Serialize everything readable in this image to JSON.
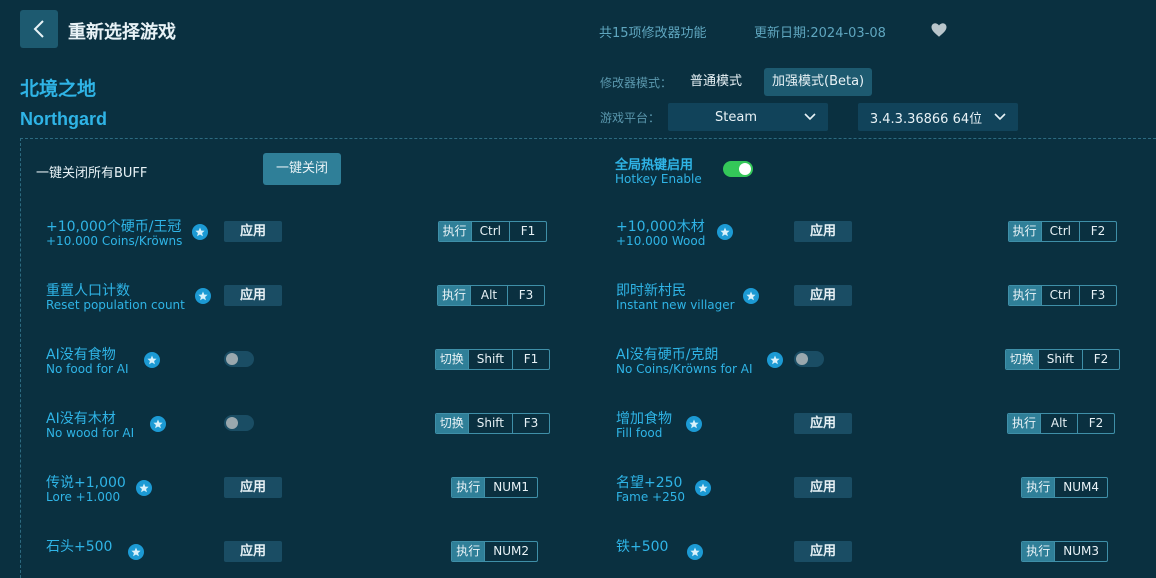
{
  "header": {
    "title": "重新选择游戏",
    "feature_count": "共15项修改器功能",
    "update_date": "更新日期:2024-03-08"
  },
  "game": {
    "name_cn": "北境之地",
    "name_en": "Northgard"
  },
  "mode": {
    "label": "修改器模式：",
    "normal": "普通模式",
    "beta": "加强模式(Beta)"
  },
  "platform": {
    "label": "游戏平台：",
    "selected": "Steam",
    "version": "3.4.3.36866 64位"
  },
  "buff": {
    "label": "一键关闭所有BUFF",
    "button": "一键关闭"
  },
  "hotkey": {
    "cn": "全局热键启用",
    "en": "Hotkey Enable",
    "enabled": true
  },
  "features": [
    {
      "cn": "+10,000个硬币/王冠",
      "en": "+10.000 Coins/Kröwns",
      "control": "apply",
      "control_label": "应用",
      "action": "执行",
      "keys": [
        "Ctrl",
        "F1"
      ]
    },
    {
      "cn": "+10,000木材",
      "en": "+10.000 Wood",
      "control": "apply",
      "control_label": "应用",
      "action": "执行",
      "keys": [
        "Ctrl",
        "F2"
      ]
    },
    {
      "cn": "重置人口计数",
      "en": "Reset population count",
      "control": "apply",
      "control_label": "应用",
      "action": "执行",
      "keys": [
        "Alt",
        "F3"
      ]
    },
    {
      "cn": "即时新村民",
      "en": "Instant new villager",
      "control": "apply",
      "control_label": "应用",
      "action": "执行",
      "keys": [
        "Ctrl",
        "F3"
      ]
    },
    {
      "cn": "AI没有食物",
      "en": "No food for AI",
      "control": "toggle",
      "action": "切换",
      "keys": [
        "Shift",
        "F1"
      ]
    },
    {
      "cn": "AI没有硬币/克朗",
      "en": "No Coins/Kröwns for AI",
      "control": "toggle",
      "action": "切换",
      "keys": [
        "Shift",
        "F2"
      ]
    },
    {
      "cn": "AI没有木材",
      "en": "No wood for AI",
      "control": "toggle",
      "action": "切换",
      "keys": [
        "Shift",
        "F3"
      ]
    },
    {
      "cn": "增加食物",
      "en": "Fill food",
      "control": "apply",
      "control_label": "应用",
      "action": "执行",
      "keys": [
        "Alt",
        "F2"
      ]
    },
    {
      "cn": "传说+1,000",
      "en": "Lore +1.000",
      "control": "apply",
      "control_label": "应用",
      "action": "执行",
      "keys": [
        "NUM1"
      ]
    },
    {
      "cn": "名望+250",
      "en": "Fame +250",
      "control": "apply",
      "control_label": "应用",
      "action": "执行",
      "keys": [
        "NUM4"
      ]
    },
    {
      "cn": "石头+500",
      "en": "",
      "control": "apply",
      "control_label": "应用",
      "action": "执行",
      "keys": [
        "NUM2"
      ]
    },
    {
      "cn": "铁+500",
      "en": "",
      "control": "apply",
      "control_label": "应用",
      "action": "执行",
      "keys": [
        "NUM3"
      ]
    }
  ]
}
